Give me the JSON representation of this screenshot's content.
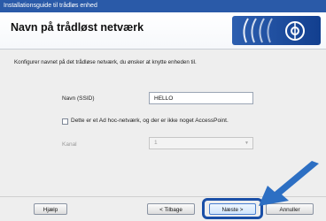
{
  "window": {
    "title": "Installationsguide til trådløs enhed"
  },
  "header": {
    "title": "Navn på trådløst netværk"
  },
  "content": {
    "instructions": "Konfigurer navnet på det trådløse netværk, du ønsker at knytte enheden til.",
    "ssid_label": "Navn (SSID)",
    "ssid_value": "HELLO",
    "adhoc_checkbox_label": "Dette er et Ad hoc-netværk, og der er ikke noget AccessPoint.",
    "adhoc_checked": false,
    "channel_label": "Kanal",
    "channel_value": "1"
  },
  "buttons": {
    "help": "Hjælp",
    "back": "< Tilbage",
    "next": "Næste >",
    "cancel": "Annuller"
  },
  "colors": {
    "titlebar": "#2a5aa8",
    "logo": "#1f4f9f",
    "highlight": "#1a4fa7",
    "arrow": "#2d6fc3"
  },
  "icons": {
    "logo": "wireless-wave-logo",
    "pointer": "arrow-pointer-icon",
    "dropdown": "chevron-down-icon"
  }
}
